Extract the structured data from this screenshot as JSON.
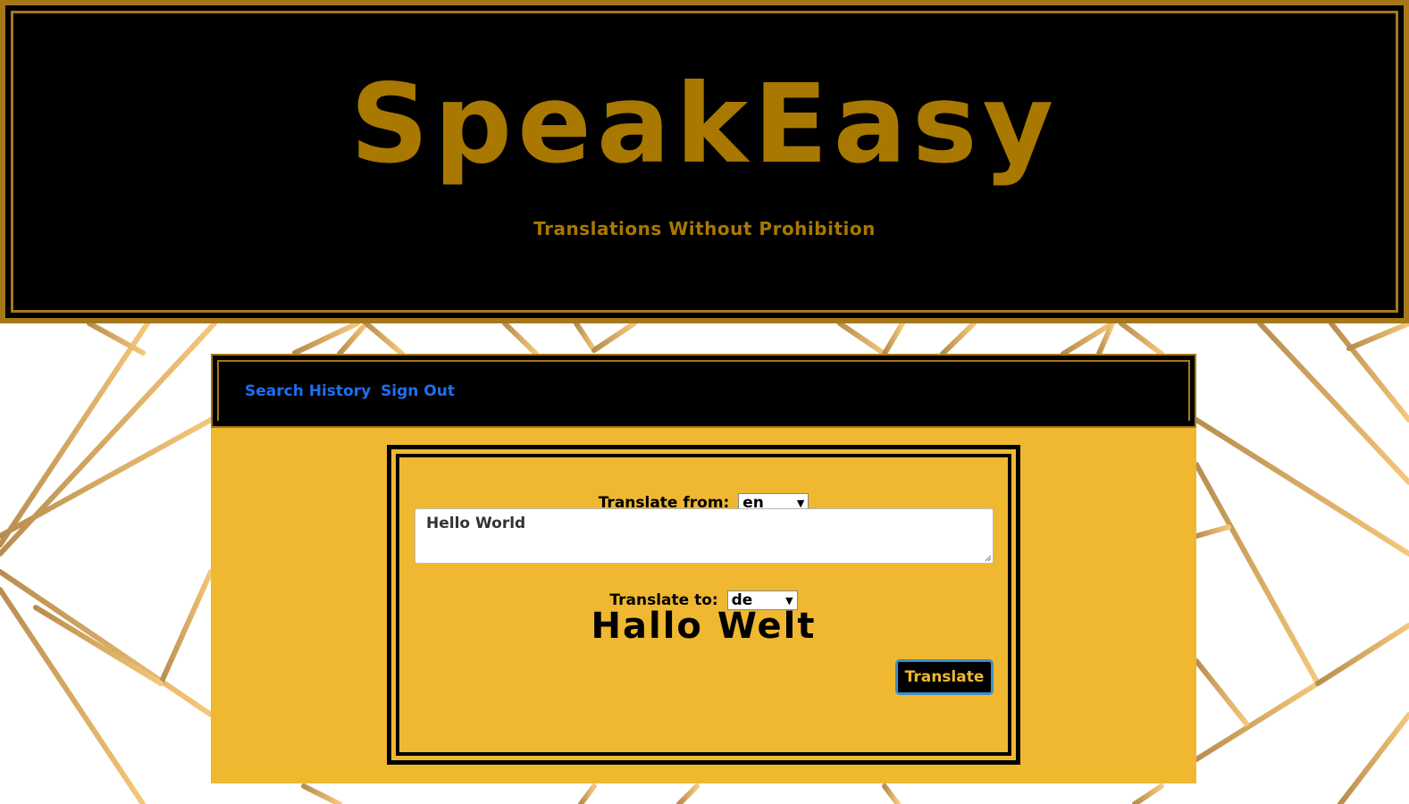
{
  "header": {
    "brand": "SpeakEasy",
    "tagline": "Translations Without Prohibition"
  },
  "nav": {
    "search_history": "Search History",
    "sign_out": "Sign Out"
  },
  "form": {
    "from_label": "Translate from:",
    "from_value": "en",
    "input_text": "Hello World",
    "to_label": "Translate to:",
    "to_value": "de",
    "output_text": "Hallo Welt",
    "button_label": "Translate"
  },
  "colors": {
    "gold": "#a87800",
    "panel": "#efb830",
    "link": "#1e6ff0",
    "button_border": "#3a8fc9"
  }
}
